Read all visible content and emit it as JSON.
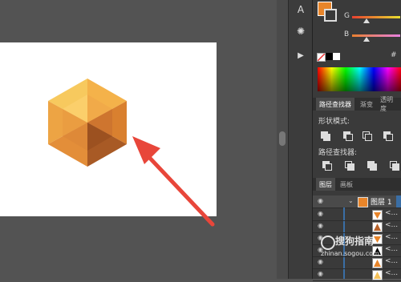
{
  "toolstrip": {
    "items": [
      {
        "icon": "type-tool-icon",
        "glyph": "A"
      },
      {
        "icon": "sun-icon",
        "glyph": "✺"
      },
      {
        "icon": "play-icon",
        "glyph": "▶"
      }
    ]
  },
  "color": {
    "g_label": "G",
    "b_label": "B",
    "hash": "#",
    "fill": "#e8852a",
    "swatches": [
      "#000000",
      "#ffffff"
    ]
  },
  "pathfinder": {
    "tabs": [
      "路径查找器",
      "渐变",
      "透明度"
    ],
    "shape_modes_label": "形状模式:",
    "pathfinders_label": "路径查找器:"
  },
  "layers": {
    "tabs": [
      "图层",
      "画板"
    ],
    "top_layer": "图层 1",
    "rows": [
      {
        "text": "<..."
      },
      {
        "text": "<..."
      },
      {
        "text": "<..."
      },
      {
        "text": "<..."
      },
      {
        "text": "<..."
      },
      {
        "text": "<..."
      }
    ]
  },
  "watermark": {
    "brand": "搜狗指南",
    "url": "zhinan.sogou.com"
  },
  "colors": {
    "gem_light": "#f5c25a",
    "gem_mid": "#e8923a",
    "gem_dark": "#b8622a",
    "arrow": "#e8463a",
    "accent_blue": "#3a6ea5"
  }
}
